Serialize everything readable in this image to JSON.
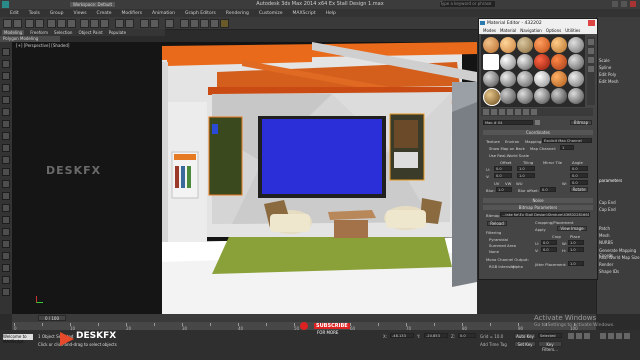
{
  "app": {
    "title": "Autodesk 3ds Max  2014 x64    Ex Stall Design 1.max",
    "workspace": "Workspace: Default",
    "menu": [
      "Edit",
      "Tools",
      "Group",
      "Views",
      "Create",
      "Modifiers",
      "Animation",
      "Graph Editors",
      "Rendering",
      "Customize",
      "MAXScript",
      "Help"
    ],
    "search_placeholder": "Type a keyword or phrase"
  },
  "ribbon": {
    "tabs": [
      "Modeling",
      "Freeform",
      "Selection",
      "Object Paint",
      "Populate"
    ],
    "active_sub": "Polygon Modeling"
  },
  "viewport": {
    "label": "[+] [Perspective] [Shaded]",
    "watermark": "DESKFX"
  },
  "material_editor": {
    "title": "Material Editor - 432202",
    "menu": [
      "Modes",
      "Material",
      "Navigation",
      "Options",
      "Utilities"
    ],
    "map_name": "Map # 04",
    "map_type": "Bitmap",
    "rollouts": {
      "coordinates": "Coordinates",
      "noise": "Noise",
      "bitmap_params": "Bitmap Parameters",
      "time": "Time",
      "output": "Output"
    },
    "coords": {
      "texture": "Texture",
      "environ": "Environ",
      "mapping_label": "Mapping:",
      "mapping_value": "Explicit Map Channel",
      "show_map_on_back": "Show Map on Back",
      "map_channel_label": "Map Channel:",
      "map_channel_value": "1",
      "use_real_world": "Use Real-World Scale",
      "offset": "Offset",
      "tiling": "Tiling",
      "mirror_tile": "Mirror Tile",
      "angle": "Angle",
      "u": "U:",
      "v": "V:",
      "w": "W:",
      "u_offset": "0.0",
      "v_offset": "0.0",
      "u_tiling": "1.0",
      "v_tiling": "1.0",
      "u_angle": "0.0",
      "v_angle": "0.0",
      "w_angle": "0.0",
      "uv": "UV",
      "vw": "VW",
      "wu": "WU",
      "blur_label": "Blur:",
      "blur_value": "1.0",
      "blur_offset_label": "Blur offset:",
      "blur_offset_value": "0.0",
      "rotate": "Rotate"
    },
    "bitmap": {
      "label": "Bitmap:",
      "path": "...Jake Ke\\Ex Stall Design\\Stmture\\43f832281661-1.jpg",
      "reload": "Reload",
      "cropping": "Cropping/Placement",
      "apply": "Apply",
      "view_image": "View Image",
      "crop": "Crop",
      "place": "Place",
      "filtering": "Filtering",
      "pyramidal": "Pyramidal",
      "summed_area": "Summed Area",
      "none": "None",
      "mono_channel": "Mono Channel Output:",
      "rgb_intensity": "RGB Intensity",
      "alpha": "Alpha",
      "jitter": "Jitter Placement:",
      "u_label": "U:",
      "w_label": "W:",
      "v_label": "V:",
      "h_label": "H:",
      "u_val": "0.0",
      "w_val": "1.0",
      "v_val": "0.0",
      "h_val": "1.0",
      "jitter_val": "1.0"
    }
  },
  "command_panel": {
    "items": [
      "Scale",
      "Spline",
      "Edit Poly",
      "Edit Mesh",
      "parameters",
      "Cap End",
      "Cap End",
      "Patch",
      "Mesh",
      "NURBS",
      "Generate Mapping Coords",
      "Real-World Map Size",
      "Render",
      "Shape IDs"
    ]
  },
  "timeline": {
    "frame": "0 / 100",
    "ticks": [
      "0",
      "10",
      "20",
      "30",
      "40",
      "50",
      "60",
      "70",
      "80",
      "90",
      "100"
    ]
  },
  "status": {
    "selection": "1 Object Selected",
    "prompt": "Click or click-and-drag to select objects",
    "x_label": "X:",
    "x_val": "-48.133",
    "y_label": "Y:",
    "y_val": "-20.853",
    "z_label": "Z:",
    "z_val": "0.0",
    "grid": "Grid = 10.0",
    "add_time_tag": "Add Time Tag",
    "auto_key": "Auto Key",
    "selected": "Selected",
    "set_key": "Set Key",
    "key_filters": "Key Filters...",
    "maxscript": "Welcome to MAXScript.",
    "brand": "DESKFX",
    "subscribe": "SUBSCRIBE",
    "subscribe_sub": "FOR MORE"
  },
  "windows_activation": {
    "line1": "Activate Windows",
    "line2": "Go to Settings to activate Windows."
  }
}
